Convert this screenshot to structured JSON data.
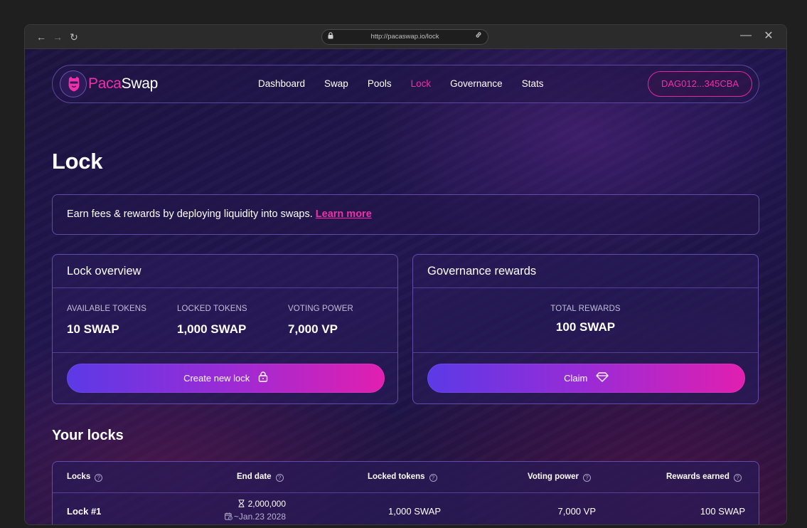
{
  "browser": {
    "url": "http://pacaswap.io/lock"
  },
  "brand": {
    "name_part1": "Paca",
    "name_part2": "Swap",
    "accent": "#f02fa8"
  },
  "nav": {
    "items": [
      {
        "label": "Dashboard",
        "active": false
      },
      {
        "label": "Swap",
        "active": false
      },
      {
        "label": "Pools",
        "active": false
      },
      {
        "label": "Lock",
        "active": true
      },
      {
        "label": "Governance",
        "active": false
      },
      {
        "label": "Stats",
        "active": false
      }
    ],
    "wallet_label": "DAG012...345CBA"
  },
  "page": {
    "title": "Lock",
    "banner_text": "Earn fees & rewards by deploying liquidity into swaps. ",
    "banner_link": "Learn more"
  },
  "lock_overview": {
    "title": "Lock overview",
    "stats": [
      {
        "label": "AVAILABLE TOKENS",
        "value": "10 SWAP"
      },
      {
        "label": "LOCKED TOKENS",
        "value": "1,000 SWAP"
      },
      {
        "label": "VOTING POWER",
        "value": "7,000 VP"
      }
    ],
    "button_label": "Create new lock",
    "button_icon": "lock-icon"
  },
  "governance_rewards": {
    "title": "Governance rewards",
    "stat_label": "TOTAL REWARDS",
    "stat_value": "100 SWAP",
    "button_label": "Claim",
    "button_icon": "diamond-icon"
  },
  "your_locks": {
    "title": "Your locks",
    "columns": [
      "Locks",
      "End date",
      "Locked tokens",
      "Voting power",
      "Rewards earned"
    ],
    "rows": [
      {
        "name": "Lock #1",
        "end_epoch": "2,000,000",
        "end_date": "~Jan.23 2028",
        "locked_tokens": "1,000 SWAP",
        "voting_power": "7,000 VP",
        "rewards_earned": "100 SWAP"
      }
    ]
  }
}
